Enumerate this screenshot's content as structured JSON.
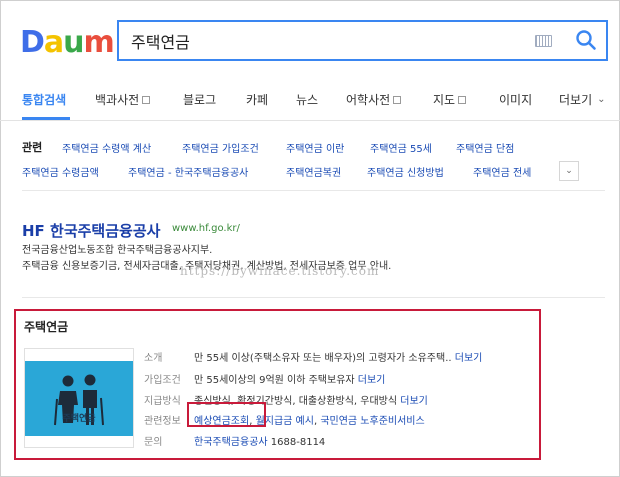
{
  "logo": {
    "letters": [
      "D",
      "a",
      "u",
      "m"
    ],
    "colors": [
      "#3f6ee8",
      "#f4c300",
      "#3aa84a",
      "#e94e3d"
    ]
  },
  "search": {
    "value": "주택연금"
  },
  "tabs": [
    {
      "label": "통합검색"
    },
    {
      "label": "백과사전"
    },
    {
      "label": "블로그"
    },
    {
      "label": "카페"
    },
    {
      "label": "뉴스"
    },
    {
      "label": "어학사전"
    },
    {
      "label": "지도"
    },
    {
      "label": "이미지"
    },
    {
      "label": "더보기"
    }
  ],
  "related": {
    "title": "관련",
    "row1": [
      "주택연금 수령액 계산",
      "주택연금 가입조건",
      "주택연금 이란",
      "주택연금 55세",
      "주택연금 단점"
    ],
    "row2": [
      "주택연금 수령금액",
      "주택연금 - 한국주택금융공사",
      "주택연금복권",
      "주택연금 신청방법",
      "주택연금 전세"
    ]
  },
  "result": {
    "title": "HF 한국주택금융공사",
    "url": "www.hf.go.kr/",
    "desc1": "전국금융산업노동조합 한국주택금융공사지부.",
    "desc2": "주택금융 신용보증기금, 전세자금대출, 주택저당채권, 계산방법, 전세자금보증 업무 안내."
  },
  "watermark": "https://bywinace.tistory.com",
  "card": {
    "title": "주택연금",
    "image_label": "주택연금",
    "rows": [
      {
        "label": "소개",
        "value": "만 55세 이상(주택소유자 또는 배우자)의 고령자가 소유주택.. ",
        "more": "더보기"
      },
      {
        "label": "가입조건",
        "value": "만 55세이상의 9억원 이하 주택보유자 ",
        "more": "더보기"
      },
      {
        "label": "지급방식",
        "value": "종신방식, 확정기간방식, 대출상환방식, 우대방식 ",
        "more": "더보기"
      },
      {
        "label": "관련정보",
        "links": [
          "예상연금조회",
          "월지급금 예시",
          "국민연금 노후준비서비스"
        ]
      },
      {
        "label": "문의",
        "link": "한국주택금융공사",
        "value": " 1688-8114"
      }
    ]
  },
  "accent_colors": {
    "blue": "#3a86f1",
    "highlight": "#c81a3a",
    "link": "#1a4bb4"
  }
}
